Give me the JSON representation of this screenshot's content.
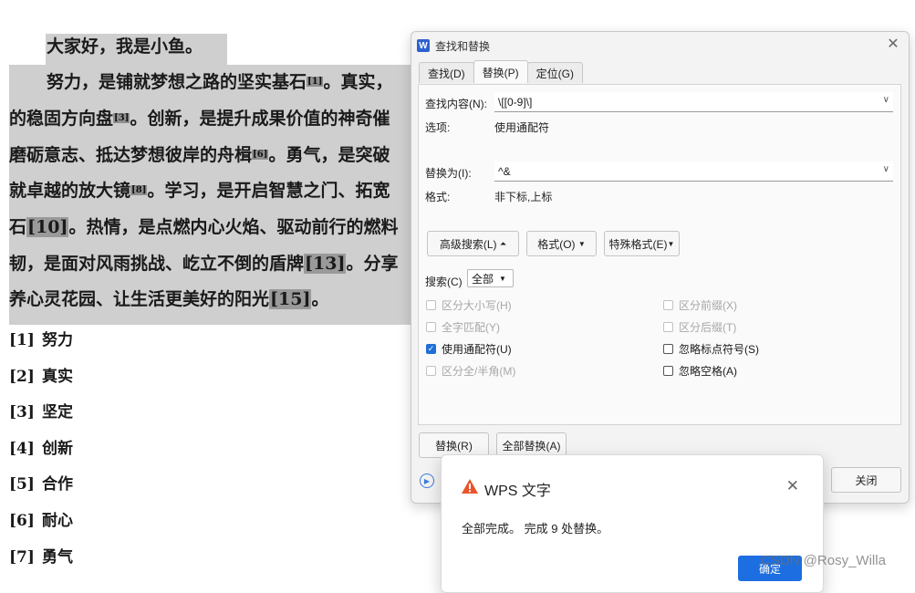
{
  "document": {
    "lines": [
      "大家好，我是小鱼。",
      "努力，是铺就梦想之路的坚实基石",
      "[1]",
      "。真实，",
      "的稳固方向盘",
      "[3]",
      "。创新，是提升成果价值的神奇催",
      "磨砺意志、抵达梦想彼岸的舟楫",
      "[6]",
      "。勇气，是突破",
      "就卓越的放大镜",
      "[8]",
      "。学习，是开启智慧之门、拓宽",
      "石",
      "[10]",
      "。热情，是点燃内心火焰、驱动前行的燃料",
      "韧，是面对风雨挑战、屹立不倒的盾牌",
      "[13]",
      "。分享",
      "养心灵花园、让生活更美好的阳光",
      "[15]",
      "。"
    ],
    "notes": [
      {
        "num": "[1]",
        "text": "努力"
      },
      {
        "num": "[2]",
        "text": "真实"
      },
      {
        "num": "[3]",
        "text": "坚定"
      },
      {
        "num": "[4]",
        "text": "创新"
      },
      {
        "num": "[5]",
        "text": "合作"
      },
      {
        "num": "[6]",
        "text": "耐心"
      },
      {
        "num": "[7]",
        "text": "勇气"
      }
    ]
  },
  "dialog": {
    "app_icon": "W",
    "title": "查找和替换",
    "tabs": [
      "查找(D)",
      "替换(P)",
      "定位(G)"
    ],
    "find_label": "查找内容(N):",
    "find_value": "\\[[0-9]\\]",
    "options_label": "选项:",
    "options_value": "使用通配符",
    "replace_label": "替换为(I):",
    "replace_value": "^&",
    "format_label": "格式:",
    "format_value": "非下标,上标",
    "advanced_btn": "高级搜索(L)",
    "format_btn": "格式(O)",
    "special_btn": "特殊格式(E)",
    "search_label": "搜索(C)",
    "search_value": "全部",
    "checks": [
      {
        "label": "区分大小写(H)",
        "checked": false,
        "disabled": true
      },
      {
        "label": "全字匹配(Y)",
        "checked": false,
        "disabled": true
      },
      {
        "label": "使用通配符(U)",
        "checked": true,
        "disabled": false
      },
      {
        "label": "区分全/半角(M)",
        "checked": false,
        "disabled": true
      },
      {
        "label": "区分前缀(X)",
        "checked": false,
        "disabled": true
      },
      {
        "label": "区分后缀(T)",
        "checked": false,
        "disabled": true
      },
      {
        "label": "忽略标点符号(S)",
        "checked": false,
        "disabled": false
      },
      {
        "label": "忽略空格(A)",
        "checked": false,
        "disabled": false
      }
    ],
    "replace_btn": "替换(R)",
    "replace_all_btn": "全部替换(A)",
    "close_btn": "关闭"
  },
  "message": {
    "title": "WPS 文字",
    "text": "全部完成。 完成 9 处替换。",
    "ok_btn": "确定"
  },
  "watermark": "CSDN @Rosy_Willa",
  "colors": {
    "accent": "#1d6ee0",
    "warning": "#e8542a",
    "selection": "#cfcfcf"
  }
}
